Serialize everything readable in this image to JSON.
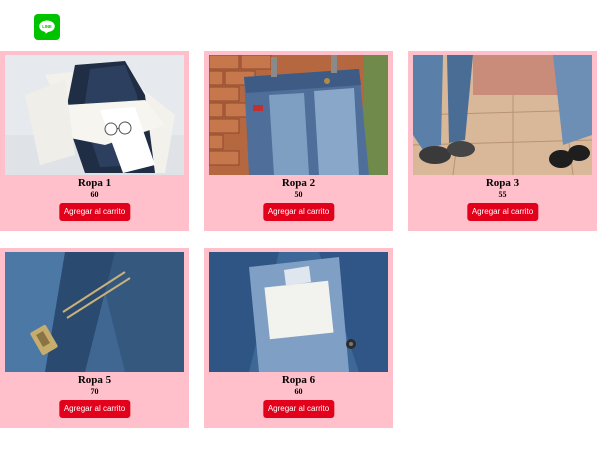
{
  "header": {
    "logo_text": "LINE",
    "logo_color": "#00c300"
  },
  "theme": {
    "card_background": "#ffc0cb",
    "button_color": "#e3001b",
    "button_text_color": "#ffffff"
  },
  "products": [
    {
      "name": "Ropa 1",
      "price": "60",
      "button_label": "Agregar al carrito",
      "image": "folded jeans with white sweater and glasses"
    },
    {
      "name": "Ropa 2",
      "price": "50",
      "button_label": "Agregar al carrito",
      "image": "jeans hanging on a clip against brick wall"
    },
    {
      "name": "Ropa 3",
      "price": "55",
      "button_label": "Agregar al carrito",
      "image": "legs in ripped jeans and sneakers on tiled floor"
    },
    {
      "name": "Ropa 5",
      "price": "70",
      "button_label": "Agregar al carrito",
      "image": "close-up of jeans zipper"
    },
    {
      "name": "Ropa 6",
      "price": "60",
      "button_label": "Agregar al carrito",
      "image": "denim jacket collar with blank label"
    }
  ]
}
